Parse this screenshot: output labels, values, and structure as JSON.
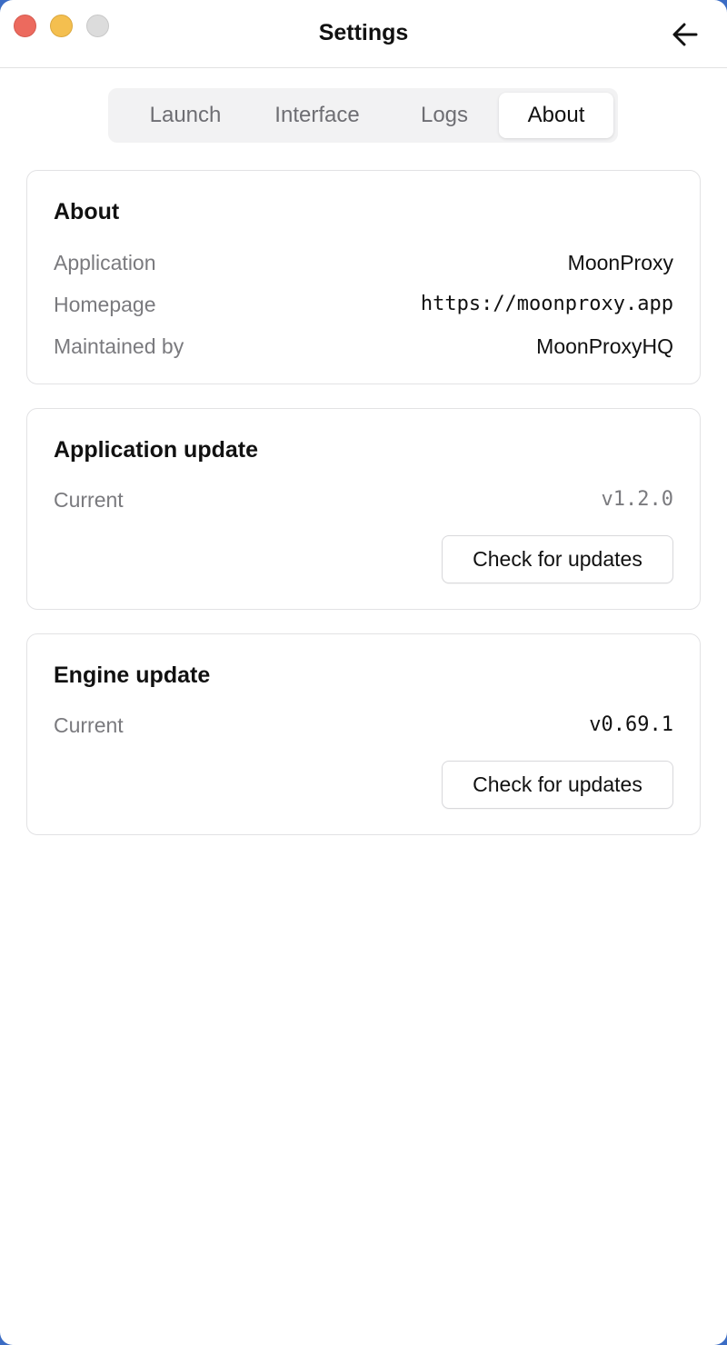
{
  "window": {
    "title": "Settings",
    "buttons": [
      "close",
      "minimize",
      "maximize"
    ]
  },
  "header": {
    "back_icon": "arrow-left-icon"
  },
  "tabs": [
    {
      "label": "Launch",
      "active": false
    },
    {
      "label": "Interface",
      "active": false
    },
    {
      "label": "Logs",
      "active": false
    },
    {
      "label": "About",
      "active": true
    }
  ],
  "about": {
    "title": "About",
    "rows": [
      {
        "label": "Application",
        "value": "MoonProxy"
      },
      {
        "label": "Homepage",
        "value": "https://moonproxy.app"
      },
      {
        "label": "Maintained by",
        "value": "MoonProxyHQ"
      }
    ]
  },
  "app_update": {
    "title": "Application update",
    "current_label": "Current",
    "current_value": "v1.2.0",
    "button_label": "Check for updates"
  },
  "engine_update": {
    "title": "Engine update",
    "current_label": "Current",
    "current_value": "v0.69.1",
    "button_label": "Check for updates"
  },
  "colors": {
    "close": "#ec6a5e",
    "minimize": "#f4bf4f",
    "maximize": "#dcdcdc"
  }
}
